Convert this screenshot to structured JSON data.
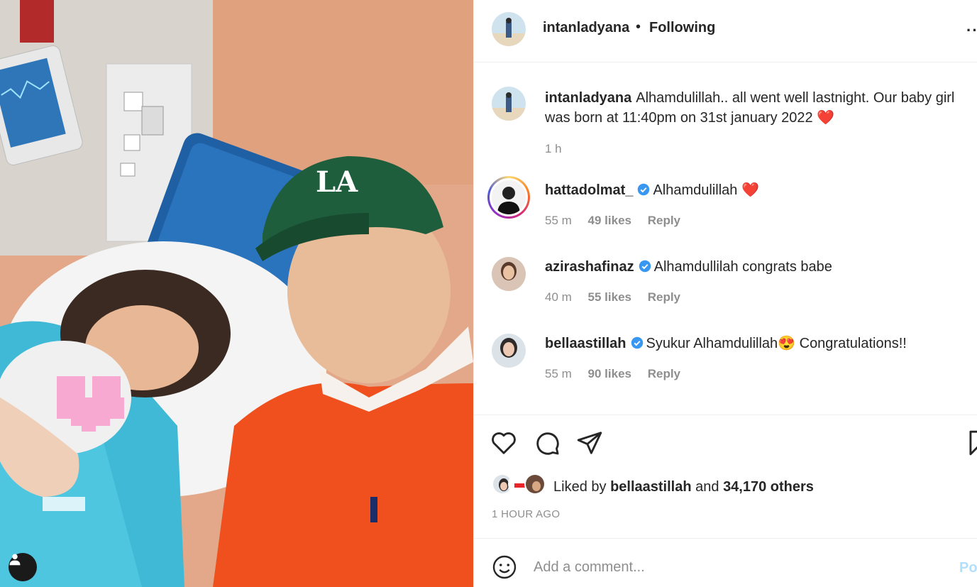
{
  "post": {
    "author": "intanladyana",
    "follow_status": "Following",
    "separator": "•",
    "more_label": "··",
    "caption": "Alhamdulillah.. all went well lastnight. Our baby girl was born at 11:40pm on 31st january 2022",
    "caption_emoji": "❤️",
    "caption_time": "1 h"
  },
  "comments": [
    {
      "user": "hattadolmat_",
      "verified": true,
      "text": "Alhamdulillah",
      "emoji": "❤️",
      "time": "55 m",
      "likes": "49 likes",
      "reply": "Reply",
      "has_story": true
    },
    {
      "user": "azirashafinaz",
      "verified": true,
      "text": "Alhamdullilah congrats babe",
      "emoji": "",
      "time": "40 m",
      "likes": "55 likes",
      "reply": "Reply",
      "has_story": false
    },
    {
      "user": "bellaastillah",
      "verified": true,
      "text": "Syukur Alhamdulillah",
      "emoji": "😍",
      "text_after": " Congratulations!!",
      "time": "55 m",
      "likes": "90 likes",
      "reply": "Reply",
      "has_story": false
    }
  ],
  "likes": {
    "prefix": "Liked by",
    "user": "bellaastillah",
    "mid": "and",
    "others": "34,170 others"
  },
  "timestamp": "1 HOUR AGO",
  "add_comment": {
    "placeholder": "Add a comment...",
    "post_label": "Po"
  },
  "colors": {
    "verified": "#3897f0",
    "post_disabled": "#b2dffc",
    "muted": "#8e8e8e"
  },
  "icons": [
    "heart-icon",
    "comment-icon",
    "share-icon",
    "bookmark-icon",
    "emoji-icon",
    "user-tag-icon",
    "verified-icon"
  ]
}
